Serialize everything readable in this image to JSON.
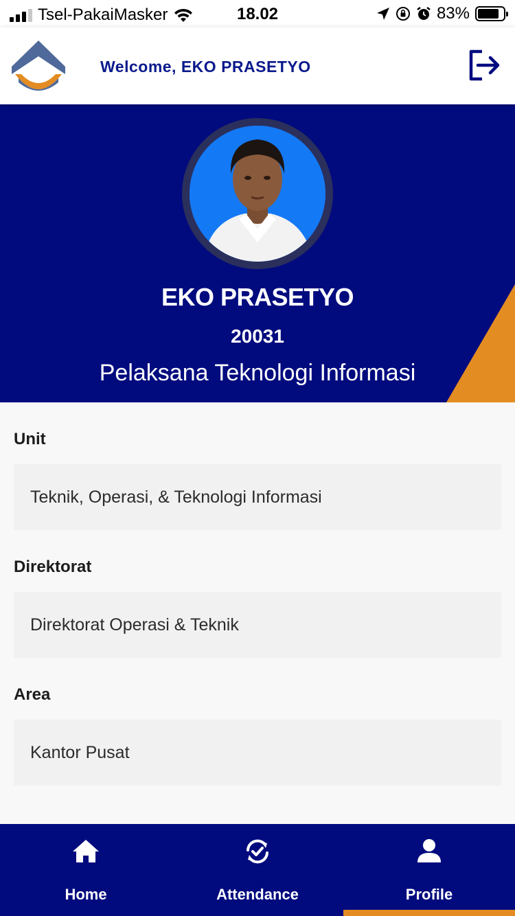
{
  "status_bar": {
    "carrier": "Tsel-PakaiMasker",
    "time": "18.02",
    "battery": "83%",
    "battery_level": 0.83
  },
  "header": {
    "welcome": "Welcome, EKO PRASETYO",
    "logo_icon": "company-logo",
    "logout_icon": "logout-icon"
  },
  "profile": {
    "name": "EKO PRASETYO",
    "employee_id": "20031",
    "position": "Pelaksana Teknologi Informasi"
  },
  "fields": [
    {
      "label": "Unit",
      "value": "Teknik, Operasi, & Teknologi Informasi"
    },
    {
      "label": "Direktorat",
      "value": "Direktorat Operasi & Teknik"
    },
    {
      "label": "Area",
      "value": "Kantor Pusat"
    }
  ],
  "nav": {
    "items": [
      {
        "label": "Home",
        "icon": "home-icon"
      },
      {
        "label": "Attendance",
        "icon": "attendance-icon"
      },
      {
        "label": "Profile",
        "icon": "profile-icon"
      }
    ],
    "active": "Profile"
  },
  "colors": {
    "primary": "#010b7e",
    "accent": "#e38c22",
    "header_text": "#0a1a8c"
  }
}
